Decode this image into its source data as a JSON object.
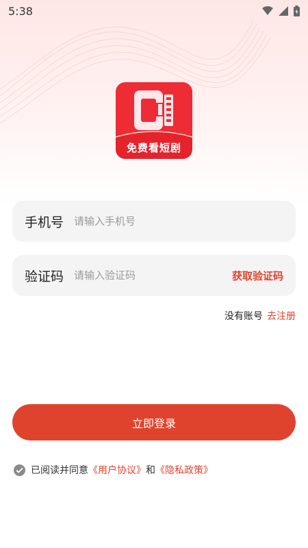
{
  "status_bar": {
    "time": "5:38",
    "icons": [
      "wifi-icon",
      "signal-icon",
      "battery-icon"
    ]
  },
  "logo": {
    "text": "免费看短剧",
    "background_color": "#ee2c36"
  },
  "form": {
    "phone": {
      "label": "手机号",
      "placeholder": "请输入手机号",
      "value": ""
    },
    "code": {
      "label": "验证码",
      "placeholder": "请输入验证码",
      "value": "",
      "get_code_label": "获取验证码"
    }
  },
  "register": {
    "prompt": "没有账号",
    "link": "去注册"
  },
  "login_button": {
    "label": "立即登录"
  },
  "agreement": {
    "prefix": "已阅读并同意",
    "user_agreement": "《用户协议》",
    "connector": "和",
    "privacy_policy": "《隐私政策》",
    "checked": true
  },
  "colors": {
    "accent": "#e0432d",
    "field_bg": "#f4f4f4",
    "logo_red": "#ee2c36"
  }
}
